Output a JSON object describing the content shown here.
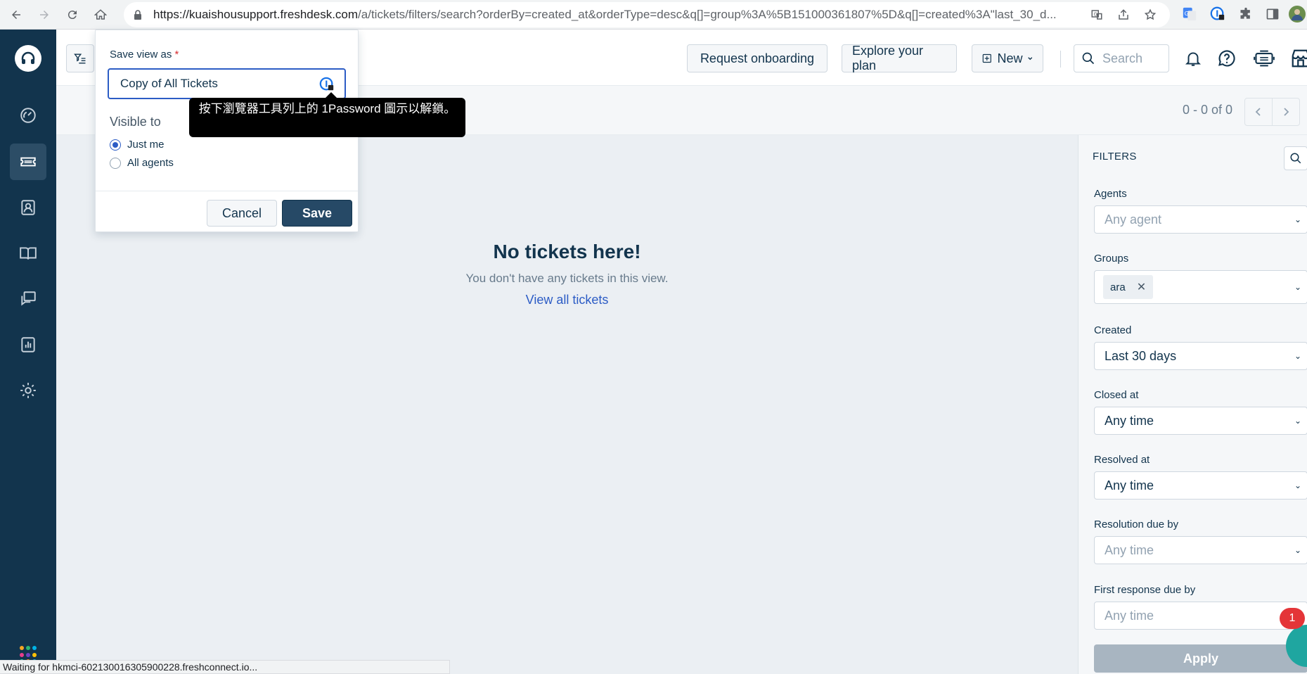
{
  "browser": {
    "url_prefix": "https://kuaishousupport.freshdesk.com",
    "url_rest": "/a/tickets/filters/search?orderBy=created_at&orderType=desc&q[]=group%3A%5B151000361807%5D&q[]=created%3A\"last_30_d..."
  },
  "header": {
    "request_onboarding": "Request onboarding",
    "explore_plan": "Explore your plan",
    "new_label": "New",
    "search_placeholder": "Search"
  },
  "pagination": {
    "range": "0 - 0 of 0"
  },
  "empty_state": {
    "title": "No tickets here!",
    "subtitle": "You don't have any tickets in this view.",
    "link": "View all tickets"
  },
  "filters": {
    "title": "FILTERS",
    "agents": {
      "label": "Agents",
      "placeholder": "Any agent"
    },
    "groups": {
      "label": "Groups",
      "chip": "ara"
    },
    "created": {
      "label": "Created",
      "value": "Last 30 days"
    },
    "closed_at": {
      "label": "Closed at",
      "value": "Any time"
    },
    "resolved_at": {
      "label": "Resolved at",
      "value": "Any time"
    },
    "resolution_due": {
      "label": "Resolution due by",
      "placeholder": "Any time"
    },
    "first_response_due": {
      "label": "First response due by",
      "placeholder": "Any time"
    },
    "apply": "Apply"
  },
  "save_view": {
    "label": "Save view as",
    "required_mark": "*",
    "input_value": "Copy of All Tickets",
    "visible_to": "Visible to",
    "option_just_me": "Just me",
    "option_all_agents": "All agents",
    "cancel": "Cancel",
    "save": "Save"
  },
  "tooltip": {
    "text": "按下瀏覽器工具列上的 1Password 圖示以解鎖。"
  },
  "status_bar": {
    "text": "Waiting for hkmci-602130016305900228.freshconnect.io..."
  },
  "chat": {
    "badge": "1"
  },
  "colors": {
    "sidebar": "#12344d",
    "accent": "#2c5cc5",
    "save_button": "#264966",
    "apply_disabled": "#a8b5c1",
    "badge": "#e43538"
  }
}
